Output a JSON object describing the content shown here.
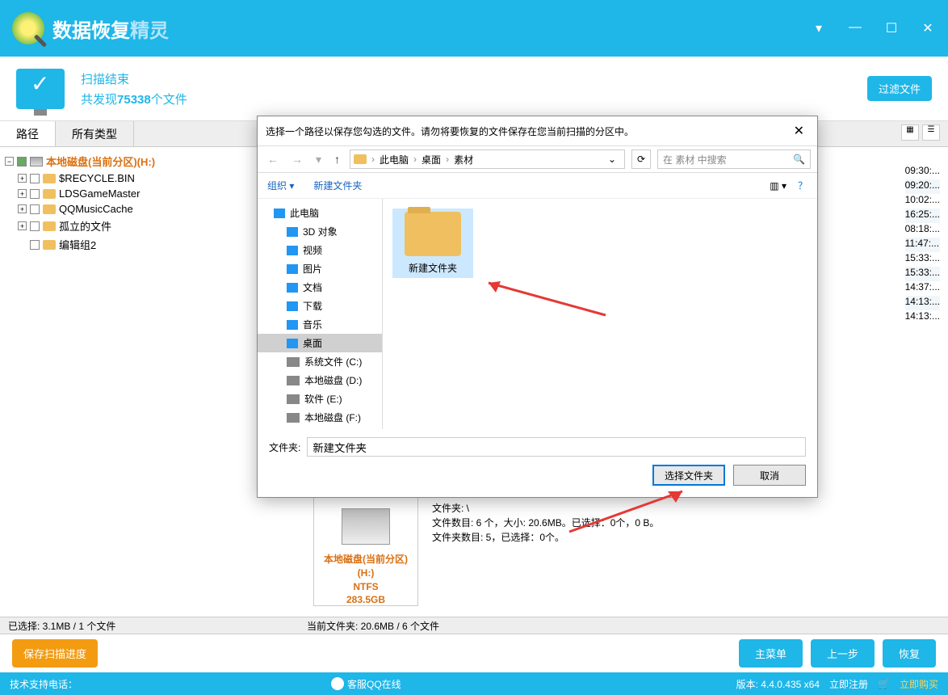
{
  "app": {
    "title_a": "数据恢复",
    "title_b": "精灵"
  },
  "status": {
    "line1": "扫描结束",
    "line2_pre": "共发现",
    "count": "75338",
    "line2_post": "个文件",
    "filter_btn": "过滤文件"
  },
  "tabs": {
    "path": "路径",
    "all_types": "所有类型"
  },
  "tree": {
    "root": "本地磁盘(当前分区)(H:)",
    "items": [
      "$RECYCLE.BIN",
      "LDSGameMaster",
      "QQMusicCache",
      "孤立的文件",
      "编辑组2"
    ]
  },
  "timestamps": [
    "09:30:...",
    "09:20:...",
    "10:02:...",
    "16:25:...",
    "08:18:...",
    "11:47:...",
    "15:33:...",
    "15:33:...",
    "14:37:...",
    "14:13:...",
    "14:13:..."
  ],
  "disk_card": {
    "line1": "本地磁盘(当前分区)(H:)",
    "line2": "NTFS",
    "line3": "283.5GB"
  },
  "folder_info": {
    "l1": "文件夹: \\",
    "l2": "文件数目: 6 个，大小: 20.6MB。已选择：0个，0 B。",
    "l3": "文件夹数目: 5，已选择：0个。"
  },
  "selection": {
    "left": "已选择: 3.1MB / 1 个文件",
    "right": "当前文件夹:  20.6MB / 6 个文件"
  },
  "actions": {
    "save_progress": "保存扫描进度",
    "main_menu": "主菜单",
    "prev": "上一步",
    "recover": "恢复"
  },
  "footer": {
    "tech_label": "技术支持电话：",
    "qq": "客服QQ在线",
    "version_label": "版本: ",
    "version": "4.4.0.435  x64",
    "register": "立即注册",
    "buy": "立即购买"
  },
  "dialog": {
    "title": "选择一个路径以保存您勾选的文件。请勿将要恢复的文件保存在您当前扫描的分区中。",
    "breadcrumb": [
      "此电脑",
      "桌面",
      "素材"
    ],
    "search_placeholder": "在 素材 中搜索",
    "organize": "组织",
    "new_folder": "新建文件夹",
    "tree": [
      {
        "label": "此电脑",
        "icon": "pc",
        "lvl": 1
      },
      {
        "label": "3D 对象",
        "icon": "3d",
        "lvl": 2
      },
      {
        "label": "视频",
        "icon": "vid",
        "lvl": 2
      },
      {
        "label": "图片",
        "icon": "img",
        "lvl": 2
      },
      {
        "label": "文档",
        "icon": "doc",
        "lvl": 2
      },
      {
        "label": "下载",
        "icon": "dl",
        "lvl": 2
      },
      {
        "label": "音乐",
        "icon": "mus",
        "lvl": 2
      },
      {
        "label": "桌面",
        "icon": "desk",
        "lvl": 2,
        "sel": true
      },
      {
        "label": "系统文件 (C:)",
        "icon": "drv",
        "lvl": 2
      },
      {
        "label": "本地磁盘 (D:)",
        "icon": "drv",
        "lvl": 2
      },
      {
        "label": "软件 (E:)",
        "icon": "drv",
        "lvl": 2
      },
      {
        "label": "本地磁盘 (F:)",
        "icon": "drv",
        "lvl": 2
      }
    ],
    "selected_folder": "新建文件夹",
    "folder_label": "文件夹:",
    "folder_value": "新建文件夹",
    "choose_btn": "选择文件夹",
    "cancel_btn": "取消"
  }
}
